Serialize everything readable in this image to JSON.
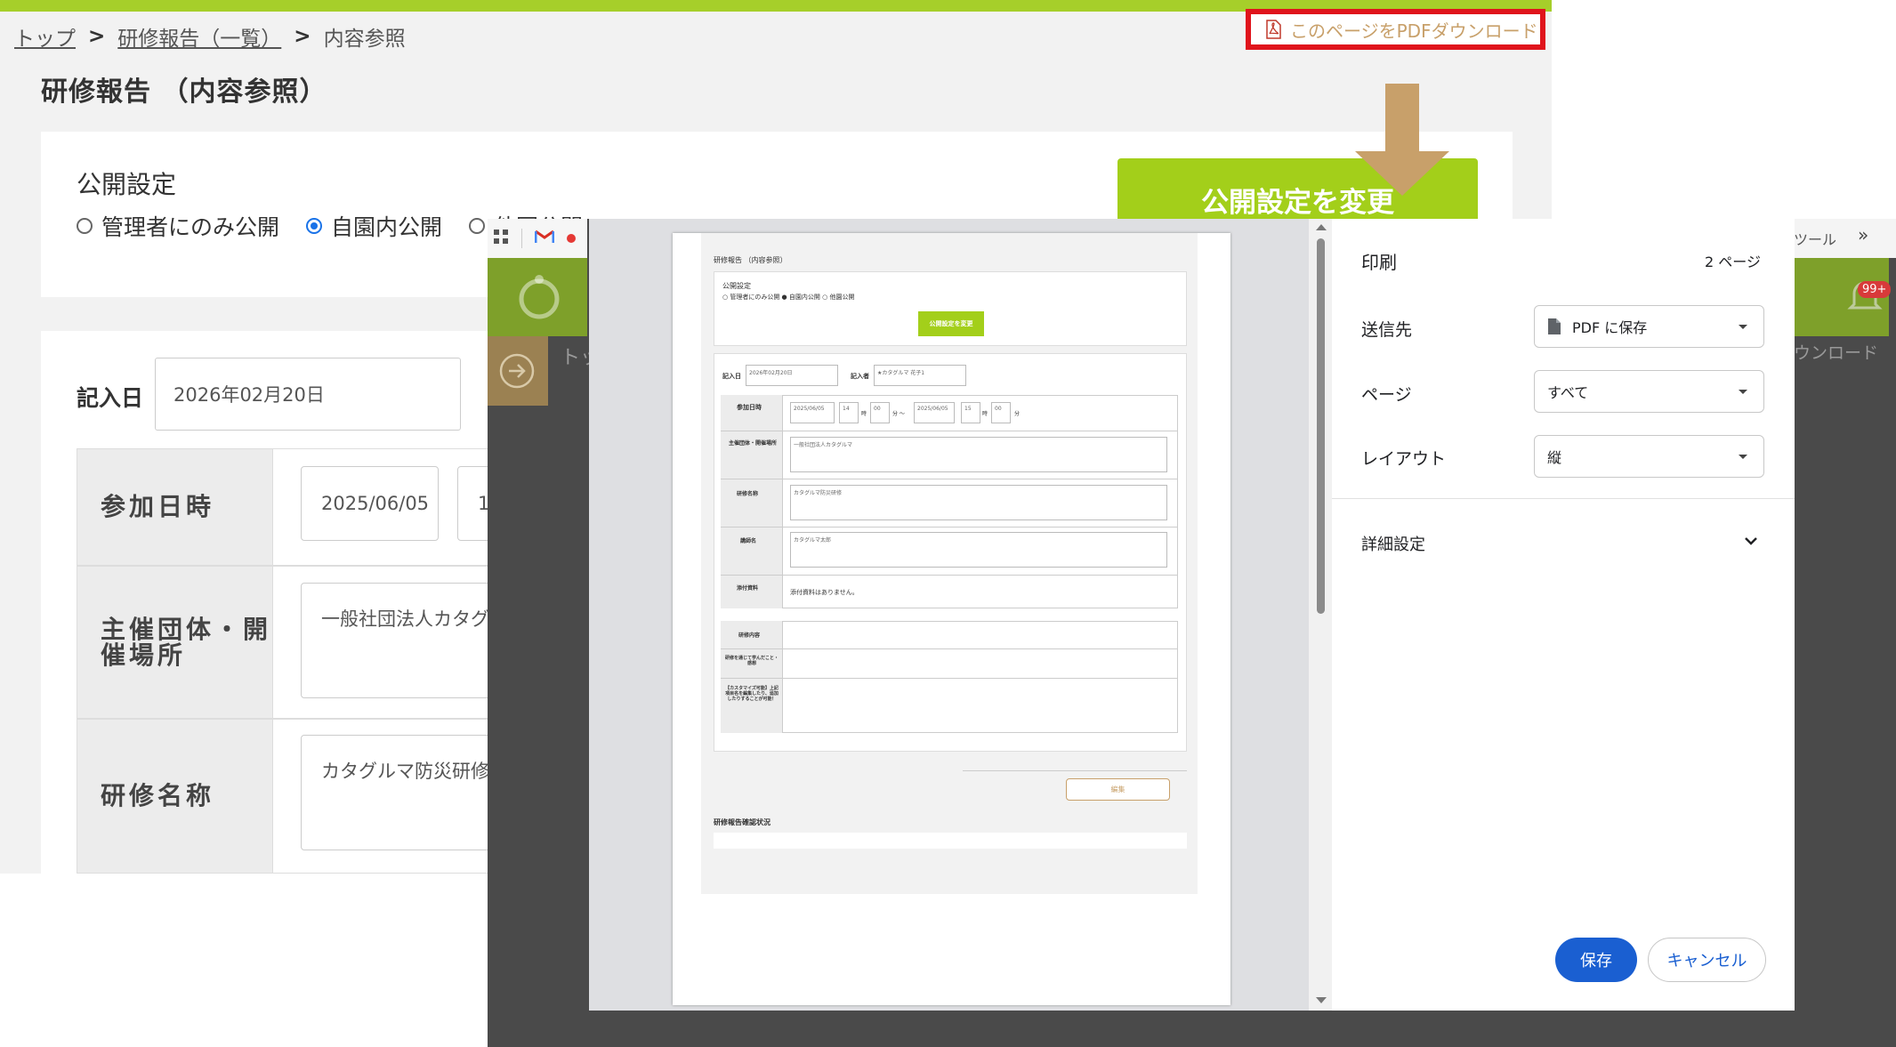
{
  "breadcrumb": {
    "top": "トップ",
    "list": "研修報告（一覧）",
    "current": "内容参照",
    "separator": ">"
  },
  "page_title": "研修報告 （内容参照）",
  "pdf_download": {
    "label": "このページをPDFダウンロード"
  },
  "publish": {
    "title": "公開設定",
    "options": [
      "管理者にのみ公開",
      "自園内公開",
      "他園公開"
    ],
    "selected": "自園内公開",
    "change_button": "公開設定を変更"
  },
  "form": {
    "entry_label": "記入日",
    "entry_date": "2026年02月20日",
    "rows": [
      {
        "label": "参加日時",
        "value": "2025/06/05",
        "value2": "1"
      },
      {
        "label": "主催団体・開催場所",
        "value": "一般社団法人カタグ"
      },
      {
        "label": "研修名称",
        "value": "カタグルマ防災研修"
      }
    ]
  },
  "background_partial": {
    "tool_label": "ツール",
    "download_partial": "ウンロード",
    "notification_badge": "99+",
    "breadcrumb_partial": "トッ"
  },
  "preview": {
    "title": "研修報告 （内容参照）",
    "publish_title": "公開設定",
    "publish_options": "○ 管理者にのみ公開 ● 自園内公開 ○ 他園公開",
    "change_button": "公開設定を変更",
    "entry_label": "記入日",
    "entry_date": "2026年02月20日",
    "writer_label": "記入者",
    "writer_value": "★カタグルマ 花子1",
    "date_label": "参加日時",
    "date_from": "2025/06/05",
    "hour_from": "14",
    "hour_unit": "時",
    "min_from": "00",
    "min_unit_tilde": "分 〜",
    "date_to": "2025/06/05",
    "hour_to": "15",
    "min_to": "00",
    "min_unit": "分",
    "org_label": "主催団体・開催場所",
    "org_value": "一般社団法人カタグルマ",
    "name_label": "研修名称",
    "name_value": "カタグルマ防災研修",
    "lecturer_label": "講師名",
    "lecturer_value": "カタグルマ太郎",
    "attach_label": "添付資料",
    "attach_value": "添付資料はありません。",
    "content_label": "研修内容",
    "learned_label": "研修を通じて学んだこと・感想",
    "custom_label": "【カスタマイズ可能】上記項目名を編集したり、追加したりすることが可能！",
    "edit_button": "編集",
    "status_title": "研修報告確認状況"
  },
  "print": {
    "title": "印刷",
    "pages": "2 ページ",
    "destination_label": "送信先",
    "destination_value": "PDF に保存",
    "pages_label": "ページ",
    "pages_value": "すべて",
    "layout_label": "レイアウト",
    "layout_value": "縦",
    "more_settings": "詳細設定",
    "save_button": "保存",
    "cancel_button": "キャンセル"
  },
  "colors": {
    "brand_green": "#a3cf1a",
    "highlight_red": "#e0141c",
    "primary_blue": "#1a5fd1",
    "accent_brown": "#c8a06a"
  }
}
